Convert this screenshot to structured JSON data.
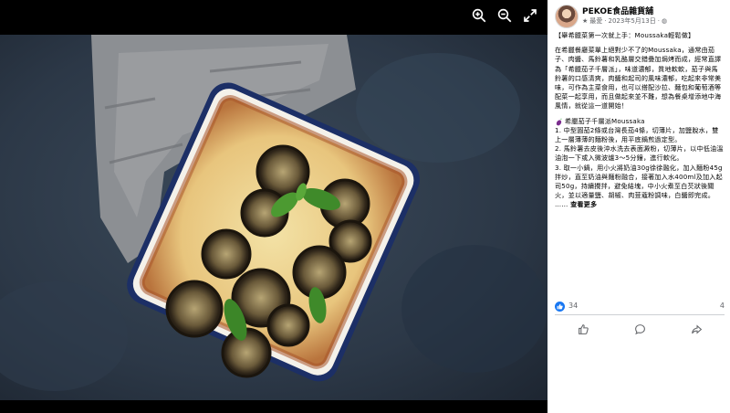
{
  "post": {
    "page_name": "PEKOE食品雜貨舖",
    "date": "2023年5月13日",
    "meta_sep": "·",
    "title": "【舉希臘菜第一次就上手：Moussaka輕鬆做】",
    "intro": "在希臘餐廳菜單上絕對少不了的Moussaka，通常由茄子、肉醬、馬鈴薯和乳酪層交錯疊加焗烤而成，經常直譯為「希臘茄子千層派」，味道濃郁，質地軟軟，茄子與馬鈴薯的口感清爽，肉醬和起司的風味濃郁，吃起來非常美味，可作為主菜食用，也可以搭配沙拉、麵包和葡萄酒等配菜一起享用，而且做起來並不難，想為餐桌增添地中海風情，就從這一道開始！",
    "recipe_title": "希臘茄子千層派Moussaka",
    "steps": [
      "1. 中型圓茄2條或台灣長茄4條，切薄片，加鹽脫水，雙上一層薄薄的麵粉後，用平底鍋煎過定型。",
      "2. 馬鈴薯去皮後沖水洗去表面澱粉，切薄片，以中低油溫油泡一下或入微波爐3～5分鐘，進行軟化。",
      "3. 取一小鍋，用小火將奶油30g徐徐融化，加入麵粉45g拌炒，直至奶油與麵粉融合，接著加入水400ml及加入起司50g，持續攪拌，避免結塊，中小火煮至白芡狀後關火，並以適量鹽、胡椒、肉荳蔻粉調味，白醬即完成。"
    ],
    "ellipsis": "……",
    "see_more": "查看更多"
  },
  "stats": {
    "likes": "34",
    "comments": "4"
  },
  "actions": {
    "like": "like-icon",
    "comment": "comment-icon",
    "share": "share-icon"
  },
  "viewer": {
    "icons": [
      "zoom-in-icon",
      "zoom-out-icon",
      "fullscreen-icon"
    ]
  },
  "colors": {
    "brand_blue": "#1877f2",
    "meta_gray": "#65676b",
    "backdrop": "#000000",
    "dish_rim": "#1c2f66"
  }
}
